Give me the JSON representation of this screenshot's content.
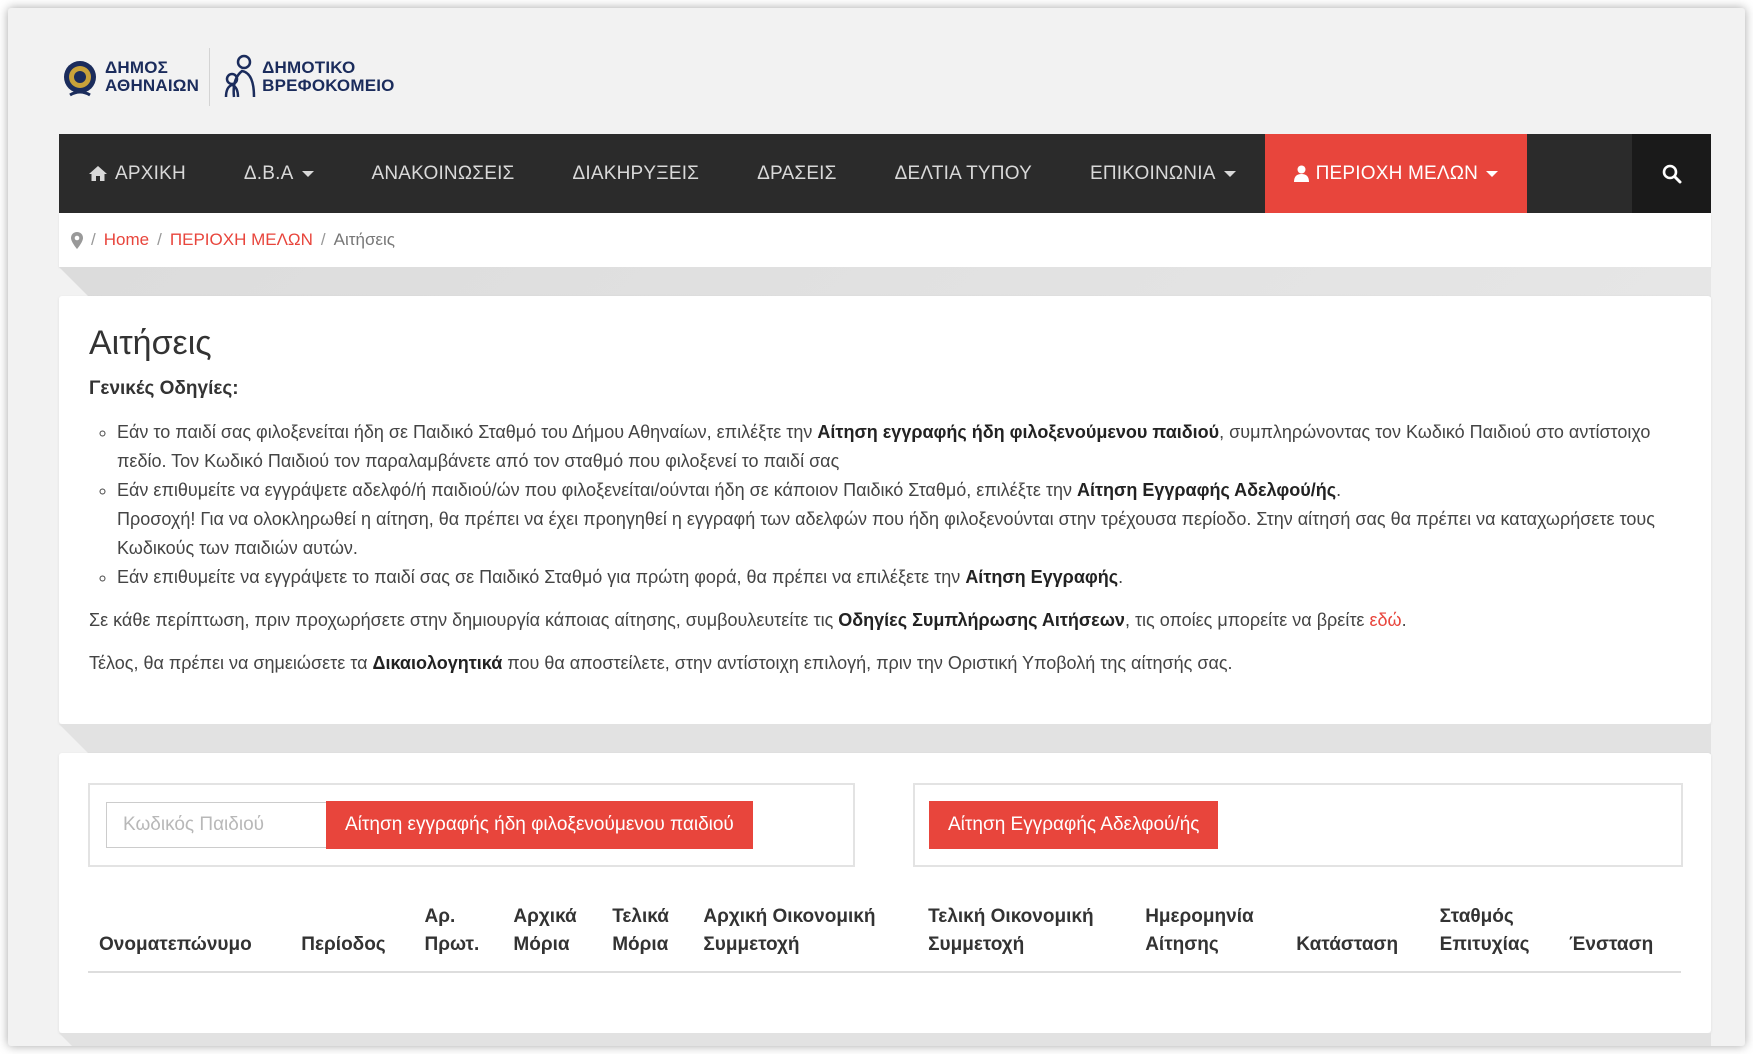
{
  "logos": {
    "municipality": [
      "ΔΗΜΟΣ",
      "ΑΘΗΝΑΙΩΝ"
    ],
    "nursery": [
      "ΔΗΜΟΤΙΚΟ",
      "ΒΡΕΦΟΚΟΜΕΙΟ"
    ]
  },
  "nav": {
    "items": [
      {
        "label": "ΑΡΧΙΚΗ",
        "icon": "home-icon",
        "dropdown": false
      },
      {
        "label": "Δ.Β.Α",
        "dropdown": true
      },
      {
        "label": "ΑΝΑΚΟΙΝΩΣΕΙΣ",
        "dropdown": false
      },
      {
        "label": "ΔΙΑΚΗΡΥΞΕΙΣ",
        "dropdown": false
      },
      {
        "label": "ΔΡΑΣΕΙΣ",
        "dropdown": false
      },
      {
        "label": "ΔΕΛΤΙΑ ΤΥΠΟΥ",
        "dropdown": false
      },
      {
        "label": "ΕΠΙΚΟΙΝΩΝΙΑ",
        "dropdown": true
      },
      {
        "label": "ΠΕΡΙΟΧΗ ΜΕΛΩΝ",
        "icon": "user-icon",
        "dropdown": true,
        "active": true
      }
    ],
    "search_icon": "search-icon",
    "active_color": "#e8453c",
    "bar_color": "#2b2b2b"
  },
  "breadcrumb": {
    "icon": "map-marker-icon",
    "items": [
      "Home",
      "ΠΕΡΙΟΧΗ ΜΕΛΩΝ",
      "Αιτήσεις"
    ]
  },
  "page": {
    "title": "Αιτήσεις",
    "subhead": "Γενικές Οδηγίες:",
    "bullet1": {
      "pre": "Εάν το παιδί σας φιλοξενείται ήδη σε Παιδικό Σταθμό του Δήμου Αθηναίων, επιλέξτε την ",
      "bold": "Αίτηση εγγραφής ήδη φιλοξενούμενου παιδιού",
      "post": ", συμπληρώνοντας τον Κωδικό Παιδιού στο αντίστοιχο πεδίο. Τον Κωδικό Παιδιού τον παραλαμβάνετε από τον σταθμό που φιλοξενεί το παιδί σας"
    },
    "bullet2": {
      "pre": "Εάν επιθυμείτε να εγγράψετε αδελφό/ή παιδιού/ών που φιλοξενείται/ούνται ήδη σε κάποιον Παιδικό Σταθμό, επιλέξτε την ",
      "bold": "Αίτηση Εγγραφής Αδελφού/ής",
      "post": ".",
      "note": "Προσοχή! Για να ολοκληρωθεί η αίτηση, θα πρέπει να έχει προηγηθεί η εγγραφή των αδελφών που ήδη φιλοξενούνται στην τρέχουσα περίοδο. Στην αίτησή σας θα πρέπει να καταχωρήσετε τους Κωδικούς των παιδιών αυτών."
    },
    "bullet3": {
      "pre": "Εάν επιθυμείτε να εγγράψετε το παιδί σας σε Παιδικό Σταθμό για πρώτη φορά, θα πρέπει να επιλέξετε την ",
      "bold": "Αίτηση Εγγραφής",
      "post": "."
    },
    "para1": {
      "pre": "Σε κάθε περίπτωση, πριν προχωρήσετε στην δημιουργία κάποιας αίτησης, συμβουλευτείτε τις ",
      "bold": "Οδηγίες Συμπλήρωσης Αιτήσεων",
      "mid": ", τις οποίες μπορείτε να βρείτε ",
      "link": "εδώ",
      "post": "."
    },
    "para2": {
      "pre": "Τέλος, θα πρέπει να σημειώσετε τα ",
      "bold": "Δικαιολογητικά",
      "post": " που θα αποστείλετε, στην αντίστοιχη επιλογή, πριν την Οριστική Υποβολή της αίτησής σας."
    }
  },
  "actions": {
    "code_placeholder": "Κωδικός Παιδιού",
    "code_value": "",
    "existing_child_button": "Αίτηση εγγραφής ήδη φιλοξενούμενου παιδιού",
    "sibling_button": "Αίτηση Εγγραφής Αδελφού/ής"
  },
  "table": {
    "columns": [
      [
        "",
        "Ονοματεπώνυμο"
      ],
      [
        "",
        "Περίοδος"
      ],
      [
        "Αρ.",
        "Πρωτ."
      ],
      [
        "Αρχικά",
        "Μόρια"
      ],
      [
        "Τελικά",
        "Μόρια"
      ],
      [
        "Αρχική Οικονομική",
        "Συμμετοχή"
      ],
      [
        "Τελική Οικονομική",
        "Συμμετοχή"
      ],
      [
        "Ημερομηνία",
        "Αίτησης"
      ],
      [
        "",
        "Κατάσταση"
      ],
      [
        "Σταθμός",
        "Επιτυχίας"
      ],
      [
        "",
        "Ένσταση"
      ]
    ],
    "rows": []
  }
}
